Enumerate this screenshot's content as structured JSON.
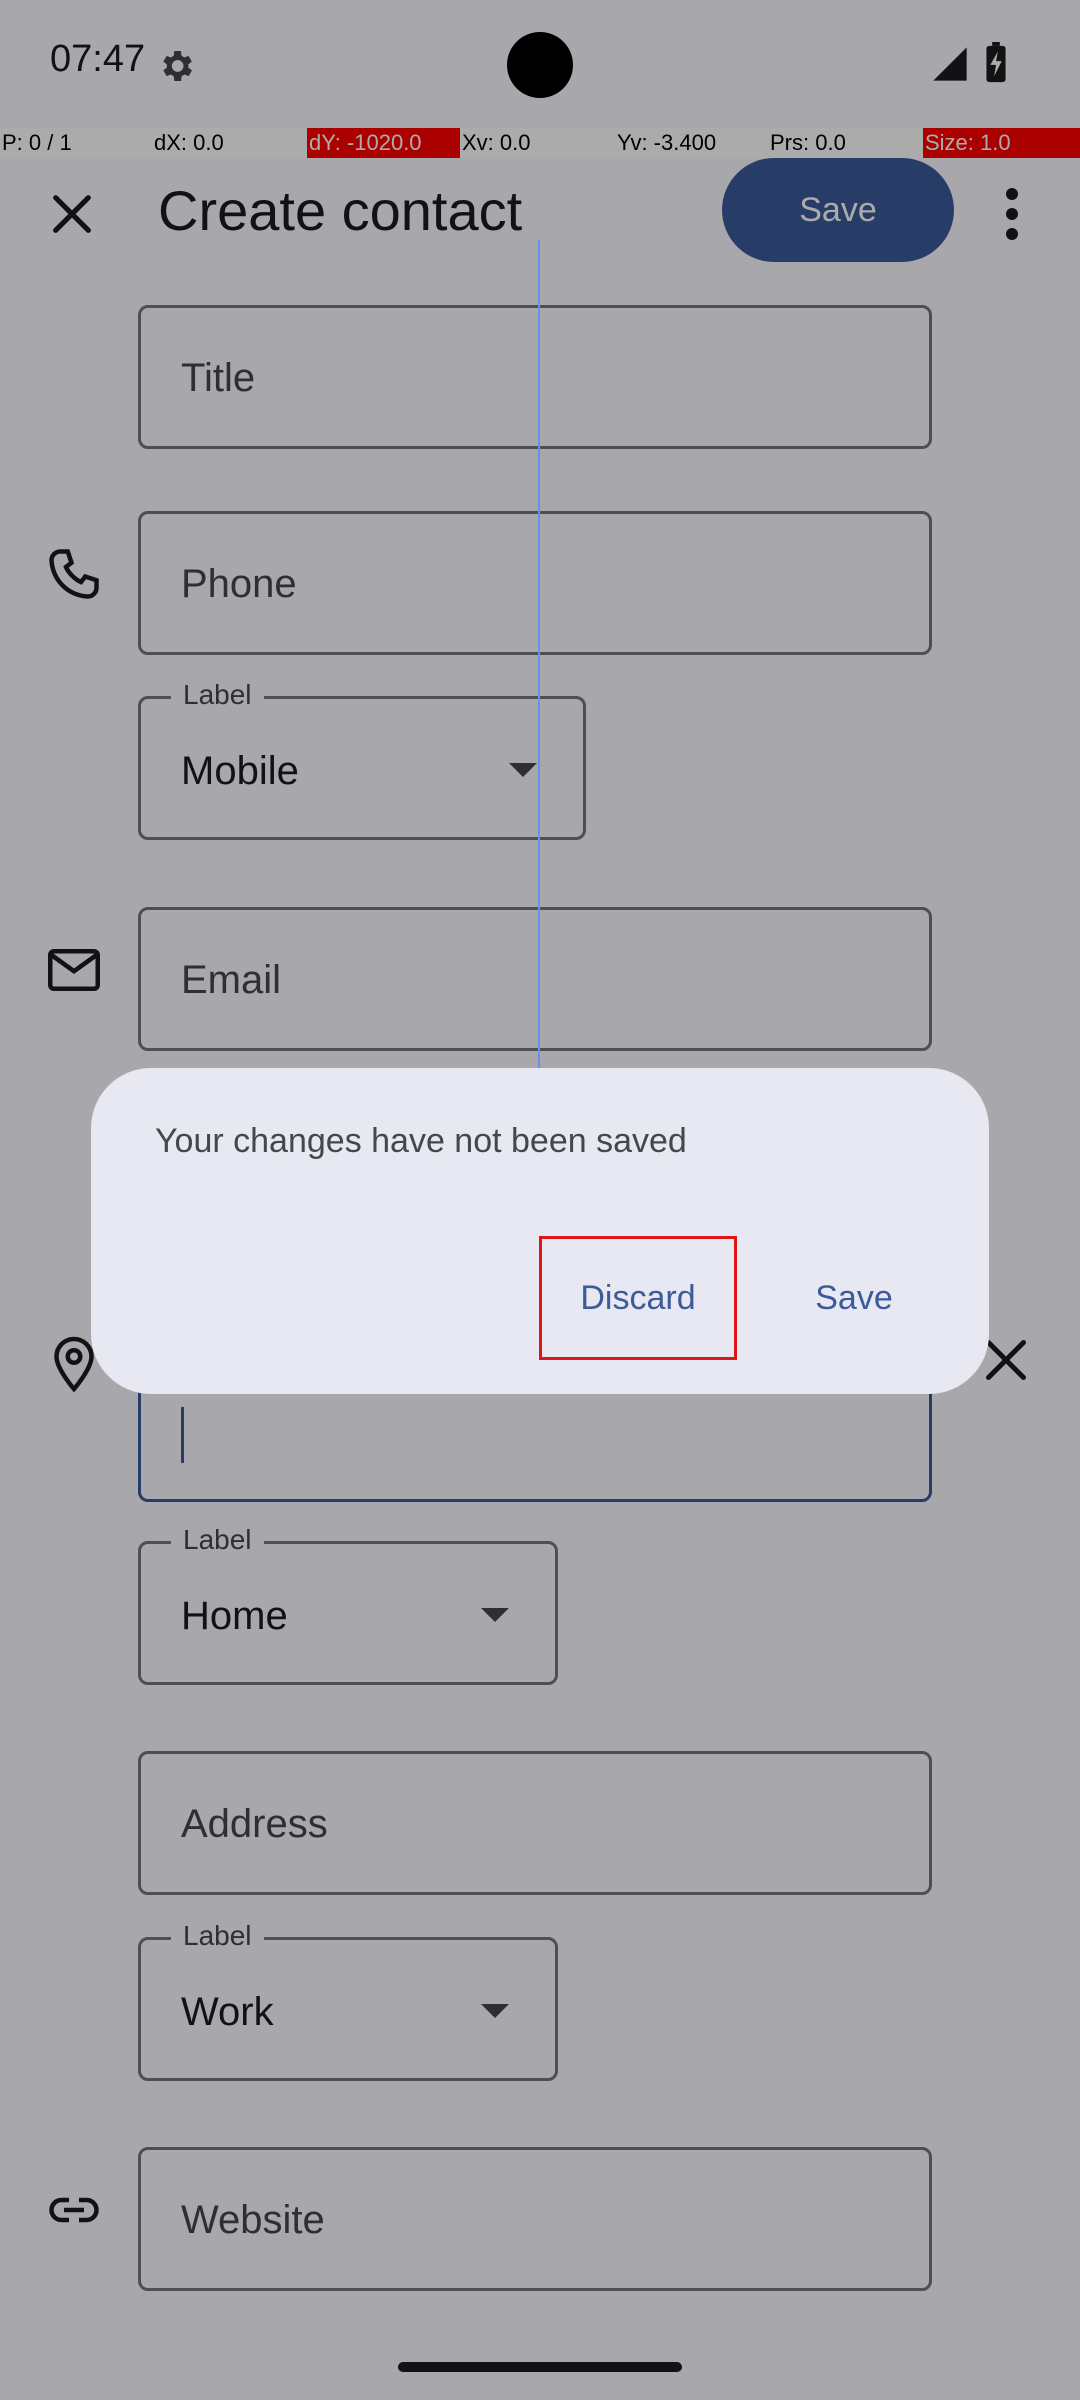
{
  "status_bar": {
    "time": "07:47",
    "settings_icon": "gear-icon",
    "signal_icon": "signal-icon",
    "battery_icon": "battery-charging-icon"
  },
  "debug": {
    "p": "P: 0 / 1",
    "dx": "dX: 0.0",
    "dy": "dY: -1020.0",
    "xv": "Xv: 0.0",
    "yv": "Yv: -3.400",
    "prs": "Prs: 0.0",
    "size": "Size: 1.0"
  },
  "app_bar": {
    "title": "Create contact",
    "save_label": "Save",
    "close_icon": "close-icon",
    "more_icon": "more-vert-icon"
  },
  "form": {
    "title_placeholder": "Title",
    "phone_placeholder": "Phone",
    "phone_label_legend": "Label",
    "phone_label_value": "Mobile",
    "email_placeholder": "Email",
    "address_label_legend": "Label",
    "address_label_value": "Home",
    "address_placeholder": "Address",
    "address2_label_legend": "Label",
    "address2_label_value": "Work",
    "website_placeholder": "Website"
  },
  "dialog": {
    "message": "Your changes have not been saved",
    "discard_label": "Discard",
    "save_label": "Save"
  },
  "colors": {
    "accent": "#3d5a9b",
    "highlight_box": "#e01616"
  }
}
